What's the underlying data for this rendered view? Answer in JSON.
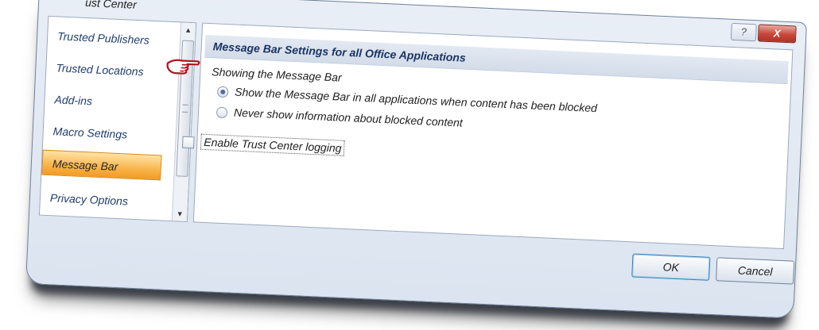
{
  "window": {
    "title": "ust Center",
    "help_label": "?",
    "close_label": "X"
  },
  "sidebar": {
    "items": [
      {
        "label": "Trusted Publishers",
        "selected": false
      },
      {
        "label": "Trusted Locations",
        "selected": false
      },
      {
        "label": "Add-ins",
        "selected": false
      },
      {
        "label": "Macro Settings",
        "selected": false
      },
      {
        "label": "Message Bar",
        "selected": true
      },
      {
        "label": "Privacy Options",
        "selected": false
      }
    ]
  },
  "content": {
    "section_title": "Message Bar Settings for all Office Applications",
    "group_label": "Showing the Message Bar",
    "options": [
      {
        "label": "Show the Message Bar in all applications when content has been blocked",
        "checked": true
      },
      {
        "label": "Never show information about blocked content",
        "checked": false
      }
    ],
    "logging_label": "Enable Trust Center logging",
    "logging_checked": false
  },
  "buttons": {
    "ok": "OK",
    "cancel": "Cancel"
  },
  "colors": {
    "selected_item": "#f8b44b",
    "close_button": "#c7463a",
    "pointer": "#b0121b"
  }
}
